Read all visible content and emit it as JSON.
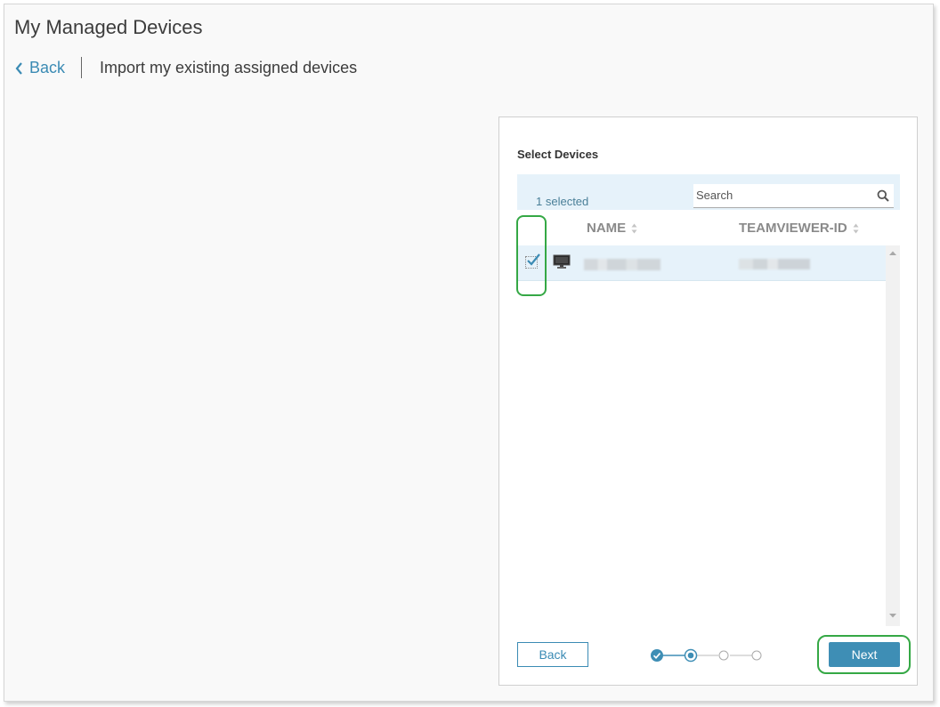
{
  "page": {
    "title": "My Managed Devices",
    "back_label": "Back",
    "subtitle": "Import my existing assigned devices"
  },
  "panel": {
    "title": "Select Devices",
    "selected_count": "1 selected",
    "search": {
      "placeholder": "Search",
      "value": ""
    },
    "columns": [
      {
        "label": "NAME",
        "sortable": true
      },
      {
        "label": "TEAMVIEWER-ID",
        "sortable": true
      }
    ],
    "rows": [
      {
        "checked": true,
        "device_icon": "monitor-icon",
        "name": "(blurred)",
        "teamviewer_id": "(blurred)"
      }
    ],
    "back_button": "Back",
    "next_button": "Next",
    "steps": {
      "total": 4,
      "completed": 1,
      "current": 2
    }
  },
  "colors": {
    "accent": "#3e8eb5",
    "selection_bg": "#e6f2fa",
    "highlight": "#35a845"
  }
}
